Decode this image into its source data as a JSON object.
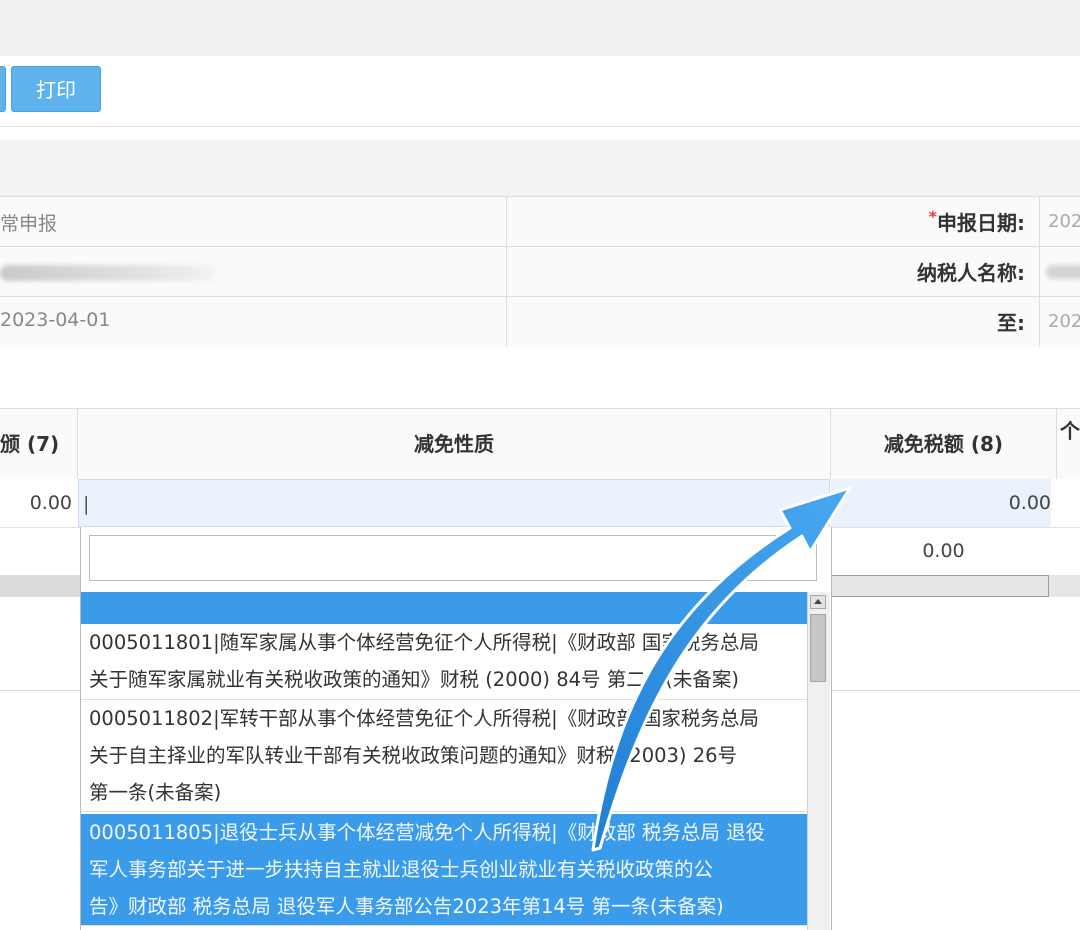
{
  "toolbar": {
    "print_label": "打印"
  },
  "info": {
    "rows": [
      {
        "left_value": "常申报",
        "label": "申报日期:",
        "required": "*",
        "right_value": "202"
      },
      {
        "left_value": "",
        "label": "纳税人名称:",
        "required": "",
        "right_value": ""
      },
      {
        "left_value": "2023-04-01",
        "label": "至:",
        "required": "",
        "right_value": "202"
      }
    ]
  },
  "table": {
    "headers": {
      "col1": "颁 (7)",
      "col2": "减免性质",
      "col3": "减免税额 (8)",
      "col4": "个"
    },
    "row1": {
      "amount": "0.00",
      "nature_value": "|",
      "tax_amount": "0.00"
    },
    "row2": {
      "tax_amount": "0.00"
    }
  },
  "dropdown": {
    "search_value": "",
    "options": [
      {
        "line1": "0005011801|随军家属从事个体经营免征个人所得税|《财政部 国家税务总局",
        "line2": "关于随军家属就业有关税收政策的通知》财税 (2000) 84号 第二条(未备案)",
        "line3": "",
        "selected": false
      },
      {
        "line1": "0005011802|军转干部从事个体经营免征个人所得税|《财政部 国家税务总局",
        "line2": "关于自主择业的军队转业干部有关税收政策问题的通知》财税 (2003) 26号",
        "line3": "第一条(未备案)",
        "selected": false
      },
      {
        "line1": "0005011805|退役士兵从事个体经营减免个人所得税|《财政部 税务总局 退役",
        "line2": "军人事务部关于进一步扶持自主就业退役士兵创业就业有关税收政策的公",
        "line3": "告》财政部 税务总局 退役军人事务部公告2023年第14号 第一条(未备案)",
        "selected": true
      }
    ]
  },
  "colors": {
    "accent": "#3a9bea",
    "button": "#5fb3ec",
    "arrow": "#2f8fe0"
  }
}
